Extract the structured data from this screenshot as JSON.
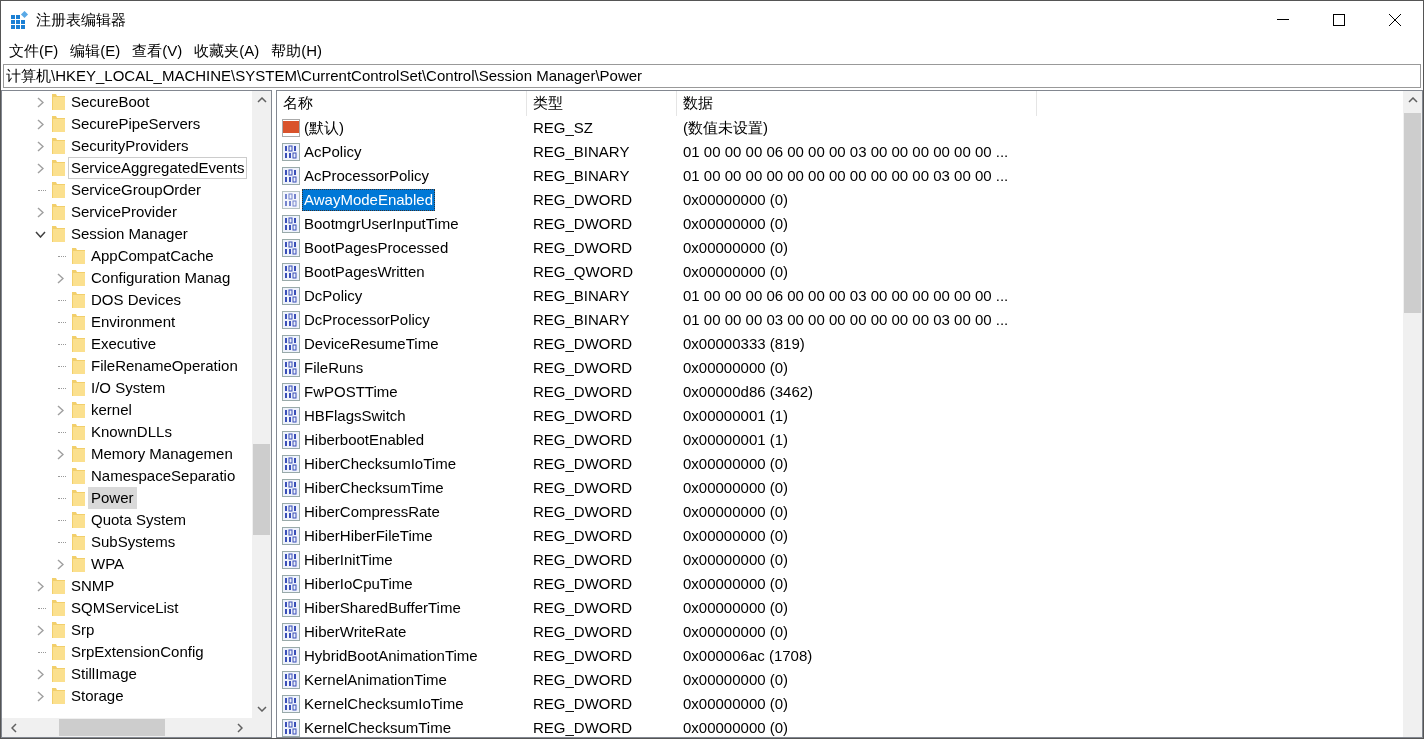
{
  "window": {
    "title": "注册表编辑器"
  },
  "menu": [
    "文件(F)",
    "编辑(E)",
    "查看(V)",
    "收藏夹(A)",
    "帮助(H)"
  ],
  "address": "计算机\\HKEY_LOCAL_MACHINE\\SYSTEM\\CurrentControlSet\\Control\\Session Manager\\Power",
  "tree": [
    {
      "label": "SecureBoot",
      "kind": "collapsed",
      "selected": false,
      "hovered": false
    },
    {
      "label": "SecurePipeServers",
      "kind": "collapsed",
      "selected": false,
      "hovered": false
    },
    {
      "label": "SecurityProviders",
      "kind": "collapsed",
      "selected": false,
      "hovered": false
    },
    {
      "label": "ServiceAggregatedEvents",
      "kind": "collapsed",
      "selected": false,
      "hovered": true
    },
    {
      "label": "ServiceGroupOrder",
      "kind": "leaf",
      "selected": false,
      "hovered": false
    },
    {
      "label": "ServiceProvider",
      "kind": "collapsed",
      "selected": false,
      "hovered": false
    },
    {
      "label": "Session Manager",
      "kind": "expanded",
      "selected": false,
      "hovered": false,
      "children": [
        {
          "label": "AppCompatCache",
          "kind": "leaf",
          "selected": false,
          "hovered": false
        },
        {
          "label": "Configuration Manag",
          "kind": "collapsed",
          "selected": false,
          "hovered": false
        },
        {
          "label": "DOS Devices",
          "kind": "leaf",
          "selected": false,
          "hovered": false
        },
        {
          "label": "Environment",
          "kind": "leaf",
          "selected": false,
          "hovered": false
        },
        {
          "label": "Executive",
          "kind": "leaf",
          "selected": false,
          "hovered": false
        },
        {
          "label": "FileRenameOperation",
          "kind": "leaf",
          "selected": false,
          "hovered": false
        },
        {
          "label": "I/O System",
          "kind": "leaf",
          "selected": false,
          "hovered": false
        },
        {
          "label": "kernel",
          "kind": "collapsed",
          "selected": false,
          "hovered": false
        },
        {
          "label": "KnownDLLs",
          "kind": "leaf",
          "selected": false,
          "hovered": false
        },
        {
          "label": "Memory Managemen",
          "kind": "collapsed",
          "selected": false,
          "hovered": false
        },
        {
          "label": "NamespaceSeparatio",
          "kind": "leaf",
          "selected": false,
          "hovered": false
        },
        {
          "label": "Power",
          "kind": "leaf",
          "selected": true,
          "hovered": false
        },
        {
          "label": "Quota System",
          "kind": "leaf",
          "selected": false,
          "hovered": false
        },
        {
          "label": "SubSystems",
          "kind": "leaf",
          "selected": false,
          "hovered": false
        },
        {
          "label": "WPA",
          "kind": "collapsed",
          "selected": false,
          "hovered": false
        }
      ]
    },
    {
      "label": "SNMP",
      "kind": "collapsed",
      "selected": false,
      "hovered": false
    },
    {
      "label": "SQMServiceList",
      "kind": "leaf",
      "selected": false,
      "hovered": false
    },
    {
      "label": "Srp",
      "kind": "collapsed",
      "selected": false,
      "hovered": false
    },
    {
      "label": "SrpExtensionConfig",
      "kind": "leaf",
      "selected": false,
      "hovered": false
    },
    {
      "label": "StillImage",
      "kind": "collapsed",
      "selected": false,
      "hovered": false
    },
    {
      "label": "Storage",
      "kind": "collapsed",
      "selected": false,
      "hovered": false
    }
  ],
  "table": {
    "columns": [
      "名称",
      "类型",
      "数据"
    ],
    "rows": [
      {
        "kind": "string",
        "name": "(默认)",
        "type": "REG_SZ",
        "data": "(数值未设置)",
        "selected": false
      },
      {
        "kind": "binary",
        "name": "AcPolicy",
        "type": "REG_BINARY",
        "data": "01 00 00 00 06 00 00 00 03 00 00 00 00 00 00 ...",
        "selected": false
      },
      {
        "kind": "binary",
        "name": "AcProcessorPolicy",
        "type": "REG_BINARY",
        "data": "01 00 00 00 00 00 00 00 00 00 00 00 03 00 00 ...",
        "selected": false
      },
      {
        "kind": "binary",
        "name": "AwayModeEnabled",
        "type": "REG_DWORD",
        "data": "0x00000000 (0)",
        "selected": true
      },
      {
        "kind": "binary",
        "name": "BootmgrUserInputTime",
        "type": "REG_DWORD",
        "data": "0x00000000 (0)",
        "selected": false
      },
      {
        "kind": "binary",
        "name": "BootPagesProcessed",
        "type": "REG_DWORD",
        "data": "0x00000000 (0)",
        "selected": false
      },
      {
        "kind": "binary",
        "name": "BootPagesWritten",
        "type": "REG_QWORD",
        "data": "0x00000000 (0)",
        "selected": false
      },
      {
        "kind": "binary",
        "name": "DcPolicy",
        "type": "REG_BINARY",
        "data": "01 00 00 00 06 00 00 00 03 00 00 00 00 00 00 ...",
        "selected": false
      },
      {
        "kind": "binary",
        "name": "DcProcessorPolicy",
        "type": "REG_BINARY",
        "data": "01 00 00 00 03 00 00 00 00 00 00 00 03 00 00 ...",
        "selected": false
      },
      {
        "kind": "binary",
        "name": "DeviceResumeTime",
        "type": "REG_DWORD",
        "data": "0x00000333 (819)",
        "selected": false
      },
      {
        "kind": "binary",
        "name": "FileRuns",
        "type": "REG_DWORD",
        "data": "0x00000000 (0)",
        "selected": false
      },
      {
        "kind": "binary",
        "name": "FwPOSTTime",
        "type": "REG_DWORD",
        "data": "0x00000d86 (3462)",
        "selected": false
      },
      {
        "kind": "binary",
        "name": "HBFlagsSwitch",
        "type": "REG_DWORD",
        "data": "0x00000001 (1)",
        "selected": false
      },
      {
        "kind": "binary",
        "name": "HiberbootEnabled",
        "type": "REG_DWORD",
        "data": "0x00000001 (1)",
        "selected": false
      },
      {
        "kind": "binary",
        "name": "HiberChecksumIoTime",
        "type": "REG_DWORD",
        "data": "0x00000000 (0)",
        "selected": false
      },
      {
        "kind": "binary",
        "name": "HiberChecksumTime",
        "type": "REG_DWORD",
        "data": "0x00000000 (0)",
        "selected": false
      },
      {
        "kind": "binary",
        "name": "HiberCompressRate",
        "type": "REG_DWORD",
        "data": "0x00000000 (0)",
        "selected": false
      },
      {
        "kind": "binary",
        "name": "HiberHiberFileTime",
        "type": "REG_DWORD",
        "data": "0x00000000 (0)",
        "selected": false
      },
      {
        "kind": "binary",
        "name": "HiberInitTime",
        "type": "REG_DWORD",
        "data": "0x00000000 (0)",
        "selected": false
      },
      {
        "kind": "binary",
        "name": "HiberIoCpuTime",
        "type": "REG_DWORD",
        "data": "0x00000000 (0)",
        "selected": false
      },
      {
        "kind": "binary",
        "name": "HiberSharedBufferTime",
        "type": "REG_DWORD",
        "data": "0x00000000 (0)",
        "selected": false
      },
      {
        "kind": "binary",
        "name": "HiberWriteRate",
        "type": "REG_DWORD",
        "data": "0x00000000 (0)",
        "selected": false
      },
      {
        "kind": "binary",
        "name": "HybridBootAnimationTime",
        "type": "REG_DWORD",
        "data": "0x000006ac (1708)",
        "selected": false
      },
      {
        "kind": "binary",
        "name": "KernelAnimationTime",
        "type": "REG_DWORD",
        "data": "0x00000000 (0)",
        "selected": false
      },
      {
        "kind": "binary",
        "name": "KernelChecksumIoTime",
        "type": "REG_DWORD",
        "data": "0x00000000 (0)",
        "selected": false
      },
      {
        "kind": "binary",
        "name": "KernelChecksumTime",
        "type": "REG_DWORD",
        "data": "0x00000000 (0)",
        "selected": false
      }
    ]
  }
}
